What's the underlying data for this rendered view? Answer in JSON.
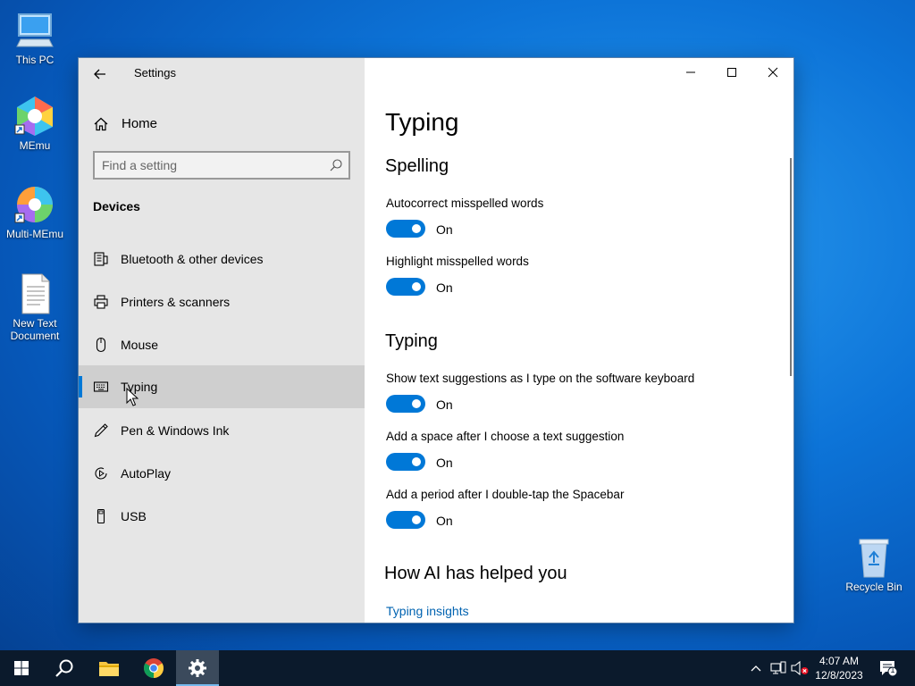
{
  "desktop": {
    "icons": [
      {
        "label": "This PC"
      },
      {
        "label": "MEmu"
      },
      {
        "label": "Multi-MEmu"
      },
      {
        "label": "New Text Document"
      },
      {
        "label": "Recycle Bin"
      }
    ]
  },
  "window": {
    "app_title": "Settings",
    "nav": {
      "home_label": "Home",
      "search_placeholder": "Find a setting",
      "section_label": "Devices",
      "items": [
        {
          "label": "Bluetooth & other devices",
          "icon": "bluetooth-devices-icon"
        },
        {
          "label": "Printers & scanners",
          "icon": "printer-icon"
        },
        {
          "label": "Mouse",
          "icon": "mouse-icon"
        },
        {
          "label": "Typing",
          "icon": "keyboard-icon",
          "selected": true
        },
        {
          "label": "Pen & Windows Ink",
          "icon": "pen-icon"
        },
        {
          "label": "AutoPlay",
          "icon": "autoplay-icon"
        },
        {
          "label": "USB",
          "icon": "usb-icon"
        }
      ]
    },
    "content": {
      "page_title": "Typing",
      "spelling": {
        "title": "Spelling",
        "settings": [
          {
            "label": "Autocorrect misspelled words",
            "state": "On"
          },
          {
            "label": "Highlight misspelled words",
            "state": "On"
          }
        ]
      },
      "typing": {
        "title": "Typing",
        "settings": [
          {
            "label": "Show text suggestions as I type on the software keyboard",
            "state": "On"
          },
          {
            "label": "Add a space after I choose a text suggestion",
            "state": "On"
          },
          {
            "label": "Add a period after I double-tap the Spacebar",
            "state": "On"
          }
        ]
      },
      "ai": {
        "title": "How AI has helped you",
        "link": "Typing insights"
      }
    }
  },
  "taskbar": {
    "time": "4:07 AM",
    "date": "12/8/2023",
    "notification_count": "1"
  },
  "colors": {
    "accent": "#0078d7",
    "nav_bg": "#e6e6e6",
    "link": "#0063b1",
    "taskbar": "#0b1a2c"
  }
}
